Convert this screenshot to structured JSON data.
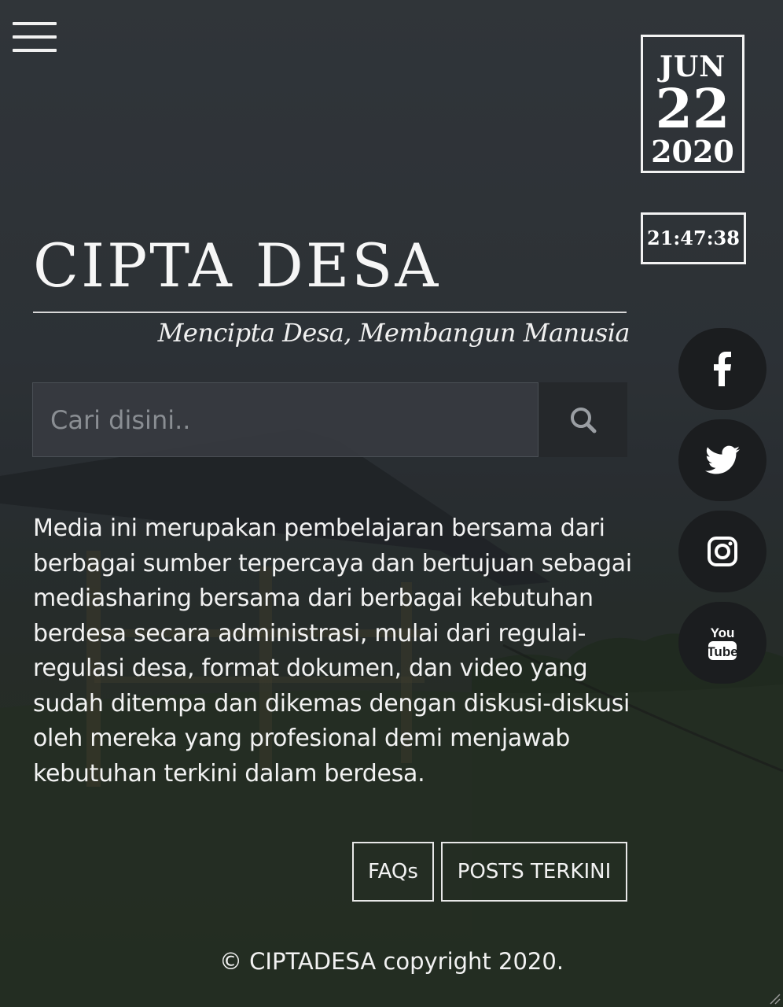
{
  "header": {
    "menu_icon": "hamburger-menu-icon"
  },
  "date": {
    "month": "JUN",
    "day": "22",
    "year": "2020"
  },
  "clock": {
    "time": "21:47:38"
  },
  "site": {
    "title": "CIPTA DESA",
    "tagline": "Mencipta Desa, Membangun Manusia"
  },
  "search": {
    "placeholder": "Cari disini..",
    "value": "",
    "button_icon": "search-icon"
  },
  "description": "Media ini merupakan pembelajaran bersama dari berbagai sumber terpercaya dan bertujuan sebagai mediasharing bersama dari berbagai kebutuhan berdesa secara administrasi, mulai dari regulai-regulasi desa, format dokumen, dan video yang sudah ditempa dan dikemas dengan diskusi-diskusi oleh mereka yang profesional demi menjawab kebutuhan terkini dalam berdesa.",
  "social": [
    {
      "name": "facebook",
      "icon": "facebook-icon"
    },
    {
      "name": "twitter",
      "icon": "twitter-icon"
    },
    {
      "name": "instagram",
      "icon": "instagram-icon"
    },
    {
      "name": "youtube",
      "icon": "youtube-icon",
      "label_top": "You",
      "label_bottom": "Tube"
    }
  ],
  "buttons": {
    "faqs": "FAQs",
    "posts": "POSTS TERKINI"
  },
  "footer": {
    "copyright": "© CIPTADESA copyright 2020."
  },
  "colors": {
    "text": "#f2f2f2",
    "social_bg": "#1b1d1f",
    "search_button_bg": "#25282b"
  }
}
